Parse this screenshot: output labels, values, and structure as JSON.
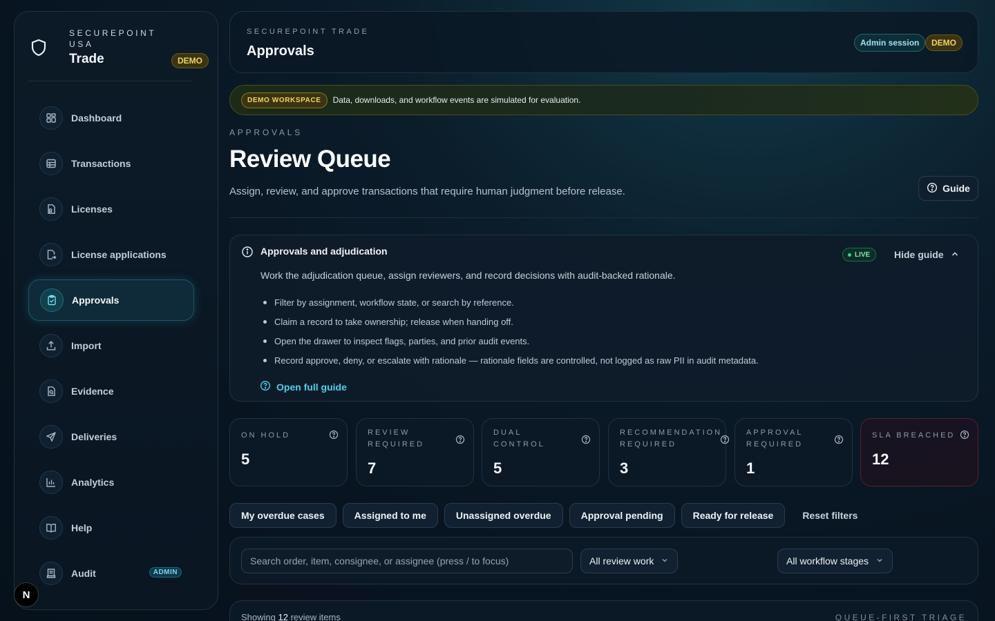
{
  "brand": {
    "kicker": "SECUREPOINT USA",
    "name": "Trade",
    "badge": "DEMO"
  },
  "nav": [
    {
      "label": "Dashboard",
      "icon": "grid-icon"
    },
    {
      "label": "Transactions",
      "icon": "table-icon"
    },
    {
      "label": "Licenses",
      "icon": "license-doc-icon"
    },
    {
      "label": "License applications",
      "icon": "doc-arrow-icon"
    },
    {
      "label": "Approvals",
      "icon": "clipboard-check-icon",
      "active": true
    },
    {
      "label": "Import",
      "icon": "upload-icon"
    },
    {
      "label": "Evidence",
      "icon": "doc-search-icon"
    },
    {
      "label": "Deliveries",
      "icon": "send-icon"
    },
    {
      "label": "Analytics",
      "icon": "bar-chart-icon"
    },
    {
      "label": "Help",
      "icon": "book-icon"
    },
    {
      "label": "Audit",
      "icon": "receipt-icon",
      "badge": "ADMIN"
    }
  ],
  "dev_badge": "N",
  "topbar": {
    "kicker": "SECUREPOINT TRADE",
    "title": "Approvals",
    "session": "Admin session",
    "badge": "DEMO"
  },
  "banner": {
    "tag": "DEMO WORKSPACE",
    "message": "Data, downloads, and workflow events are simulated for evaluation."
  },
  "section": {
    "kicker": "APPROVALS",
    "title": "Review Queue",
    "subtitle": "Assign, review, and approve transactions that require human judgment before release.",
    "guide_button": "Guide"
  },
  "guide": {
    "title": "Approvals and adjudication",
    "status": "LIVE",
    "hide_label": "Hide guide",
    "description": "Work the adjudication queue, assign reviewers, and record decisions with audit-backed rationale.",
    "bullets": [
      "Filter by assignment, workflow state, or search by reference.",
      "Claim a record to take ownership; release when handing off.",
      "Open the drawer to inspect flags, parties, and prior audit events.",
      "Record approve, deny, or escalate with rationale — rationale fields are controlled, not logged as raw PII in audit metadata."
    ],
    "open_full": "Open full guide"
  },
  "stats": [
    {
      "label": "ON HOLD",
      "value": "5"
    },
    {
      "label": "REVIEW REQUIRED",
      "value": "7"
    },
    {
      "label": "DUAL CONTROL",
      "value": "5"
    },
    {
      "label": "RECOMMENDATION REQUIRED",
      "value": "3"
    },
    {
      "label": "APPROVAL REQUIRED",
      "value": "1"
    },
    {
      "label": "SLA BREACHED",
      "value": "12"
    }
  ],
  "chips": [
    "My overdue cases",
    "Assigned to me",
    "Unassigned overdue",
    "Approval pending",
    "Ready for release"
  ],
  "reset": "Reset filters",
  "search": {
    "placeholder": "Search order, item, consignee, or assignee (press / to focus)",
    "review_filter": "All review work",
    "stage_filter": "All workflow stages"
  },
  "results": {
    "prefix": "Showing",
    "count": "12",
    "suffix": "review items",
    "mode": "QUEUE-FIRST TRIAGE"
  },
  "colors": {
    "accent": "#4fd0e8",
    "demo": "#f1d35c",
    "live": "#35d49a",
    "breach_border": "#5a1e30"
  }
}
